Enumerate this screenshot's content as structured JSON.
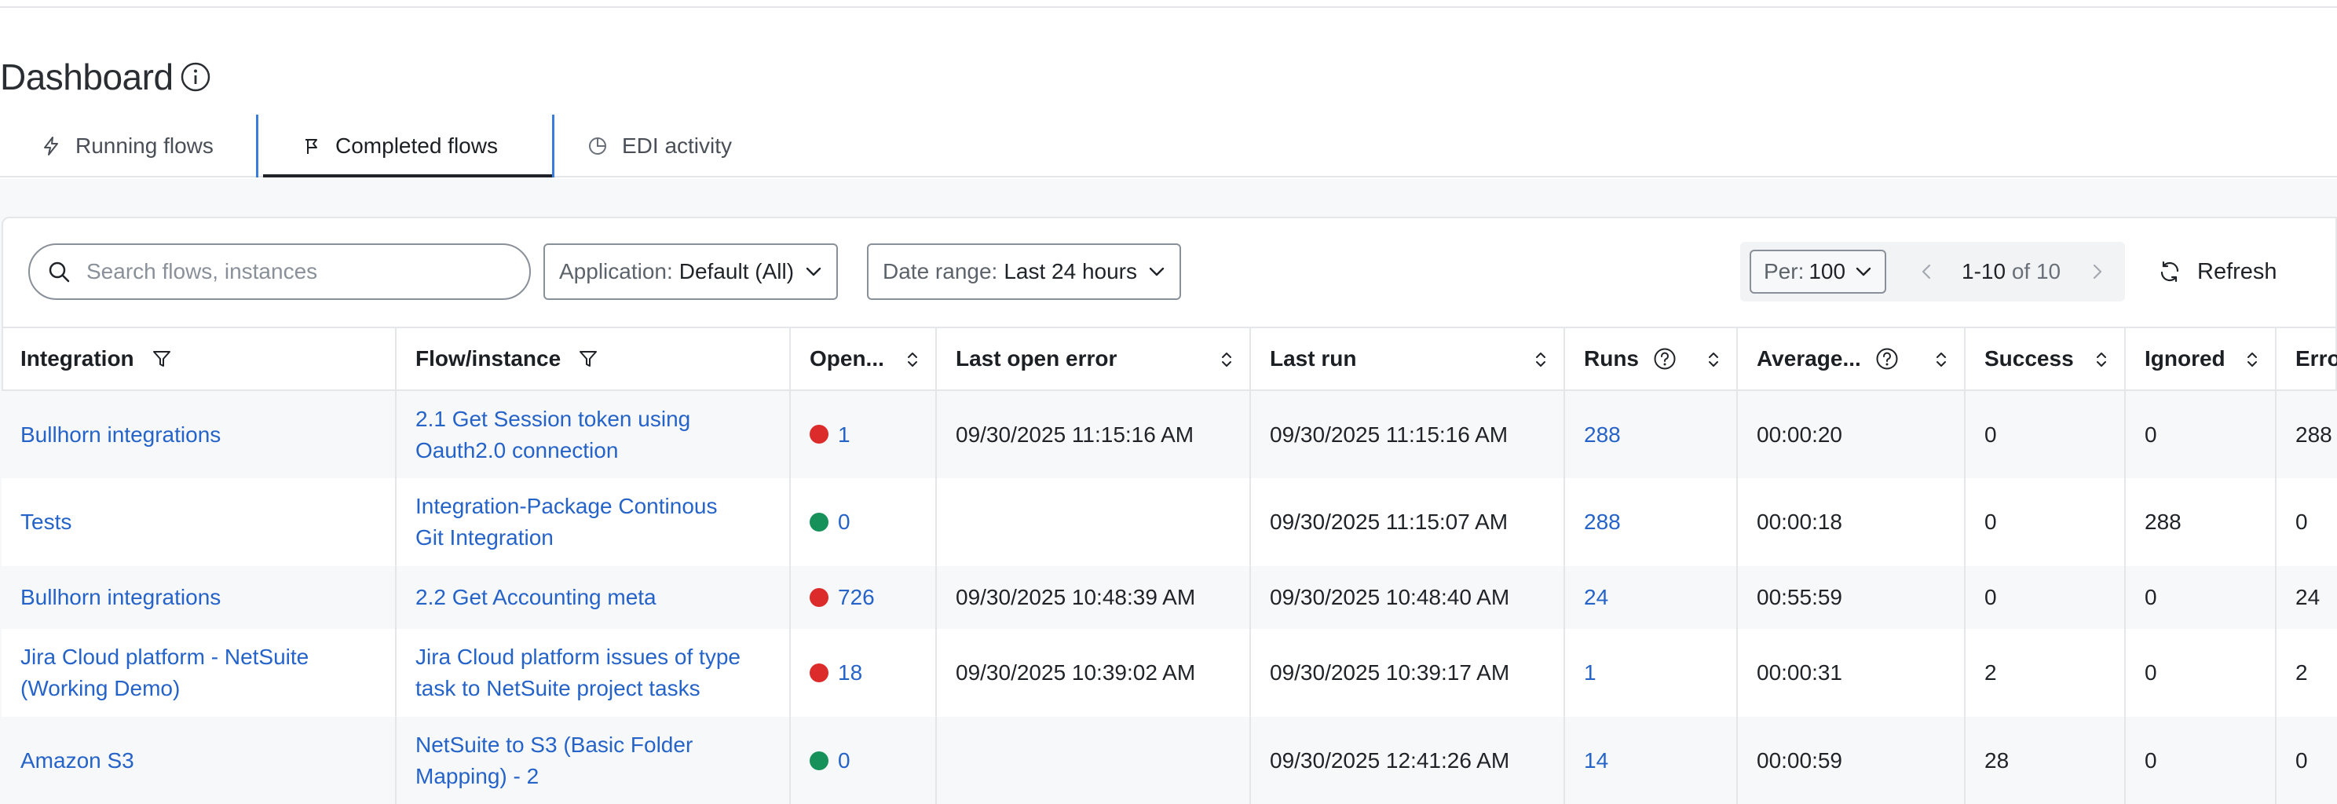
{
  "page": {
    "title": "Dashboard"
  },
  "tabs": [
    {
      "label": "Running flows",
      "icon": "bolt-icon",
      "active": false
    },
    {
      "label": "Completed flows",
      "icon": "flag-icon",
      "active": true
    },
    {
      "label": "EDI activity",
      "icon": "pie-chart-icon",
      "active": false
    }
  ],
  "toolbar": {
    "search_placeholder": "Search flows, instances",
    "application_label": "Application:",
    "application_value": "Default (All)",
    "date_label": "Date range:",
    "date_value": "Last 24 hours",
    "per_label": "Per:",
    "per_value": "100",
    "range": "1-10",
    "range_of": "of 10",
    "refresh_label": "Refresh"
  },
  "table": {
    "columns": [
      "Integration",
      "Flow/instance",
      "Open...",
      "Last open error",
      "Last run",
      "Runs",
      "Average...",
      "Success",
      "Ignored",
      "Errors"
    ],
    "rows": [
      {
        "integration": [
          "Bullhorn integrations"
        ],
        "flow": [
          "2.1 Get Session token using",
          "Oauth2.0 connection"
        ],
        "open_status": "error",
        "open": "1",
        "last_open_error": "09/30/2025 11:15:16 AM",
        "last_run": "09/30/2025 11:15:16 AM",
        "runs": "288",
        "average": "00:00:20",
        "success": "0",
        "ignored": "0",
        "errors": "288"
      },
      {
        "integration": [
          "Tests"
        ],
        "flow": [
          "Integration-Package Continous",
          "Git Integration"
        ],
        "open_status": "ok",
        "open": "0",
        "last_open_error": "",
        "last_run": "09/30/2025 11:15:07 AM",
        "runs": "288",
        "average": "00:00:18",
        "success": "0",
        "ignored": "288",
        "errors": "0"
      },
      {
        "integration": [
          "Bullhorn integrations"
        ],
        "flow": [
          "2.2 Get Accounting meta"
        ],
        "open_status": "error",
        "open": "726",
        "last_open_error": "09/30/2025 10:48:39 AM",
        "last_run": "09/30/2025 10:48:40 AM",
        "runs": "24",
        "average": "00:55:59",
        "success": "0",
        "ignored": "0",
        "errors": "24"
      },
      {
        "integration": [
          "Jira Cloud platform - NetSuite",
          "(Working Demo)"
        ],
        "flow": [
          "Jira Cloud platform issues of type",
          "task to NetSuite project tasks"
        ],
        "open_status": "error",
        "open": "18",
        "last_open_error": "09/30/2025 10:39:02 AM",
        "last_run": "09/30/2025 10:39:17 AM",
        "runs": "1",
        "average": "00:00:31",
        "success": "2",
        "ignored": "0",
        "errors": "2"
      },
      {
        "integration": [
          "Amazon S3"
        ],
        "flow": [
          "NetSuite to S3 (Basic Folder",
          "Mapping) - 2"
        ],
        "open_status": "ok",
        "open": "0",
        "last_open_error": "",
        "last_run": "09/30/2025 12:41:26 AM",
        "runs": "14",
        "average": "00:00:59",
        "success": "28",
        "ignored": "0",
        "errors": "0"
      }
    ]
  },
  "colors": {
    "link": "#2563c9",
    "error_dot": "#dc2b2b",
    "ok_dot": "#17915a",
    "tab_accent": "#3b7ddd"
  }
}
